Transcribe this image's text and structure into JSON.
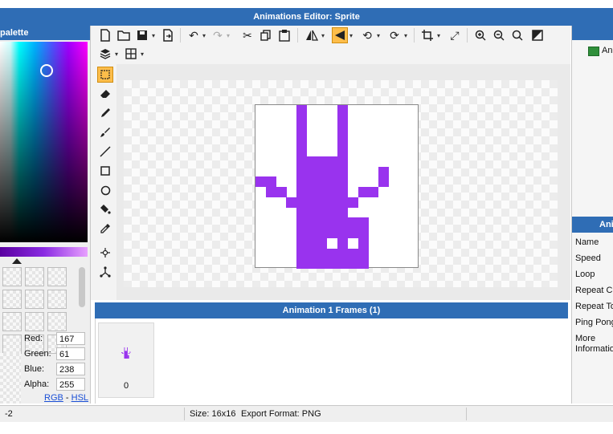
{
  "window": {
    "title": "Animations Editor: Sprite"
  },
  "palette": {
    "title": "palette",
    "red_label": "Red:",
    "red_value": "167",
    "green_label": "Green:",
    "green_value": "61",
    "blue_label": "Blue:",
    "blue_value": "238",
    "alpha_label": "Alpha:",
    "alpha_value": "255",
    "rgb_link": "RGB",
    "link_separator": " - ",
    "hsl_link": "HSL"
  },
  "toolbar": {
    "icons": [
      "new-file-icon",
      "open-folder-icon",
      "save-icon",
      "export-icon",
      "undo-icon",
      "redo-icon",
      "cut-icon",
      "copy-icon",
      "paste-icon",
      "flip-horizontal-icon",
      "flip-vertical-icon",
      "rotate-left-icon",
      "rotate-right-icon",
      "crop-icon",
      "resize-icon",
      "zoom-in-icon",
      "zoom-out-icon",
      "zoom-fit-icon",
      "background-icon",
      "layers-icon",
      "grid-icon"
    ],
    "selected": "flip-vertical-icon"
  },
  "tools": {
    "items": [
      "select-tool",
      "eraser-tool",
      "pencil-tool",
      "brush-tool",
      "line-tool",
      "rectangle-tool",
      "ellipse-tool",
      "fill-tool",
      "eyedropper-tool",
      "center-tool",
      "transform-tool"
    ],
    "selected": "select-tool"
  },
  "accent_color": "#9933ee",
  "header_color": "#2f6db5",
  "frames": {
    "title": "Animation 1 Frames (1)",
    "items": [
      {
        "index": "0"
      }
    ]
  },
  "right_panel": {
    "top_item": "An",
    "props_title": "Ani",
    "rows": [
      "Name",
      "Speed",
      "Loop",
      "Repeat Co",
      "Repeat To",
      "Ping Pong",
      "More",
      "Informatio"
    ]
  },
  "status": {
    "left": "-2",
    "size_text": "Size: 16x16",
    "format_text": "Export Format: PNG"
  }
}
